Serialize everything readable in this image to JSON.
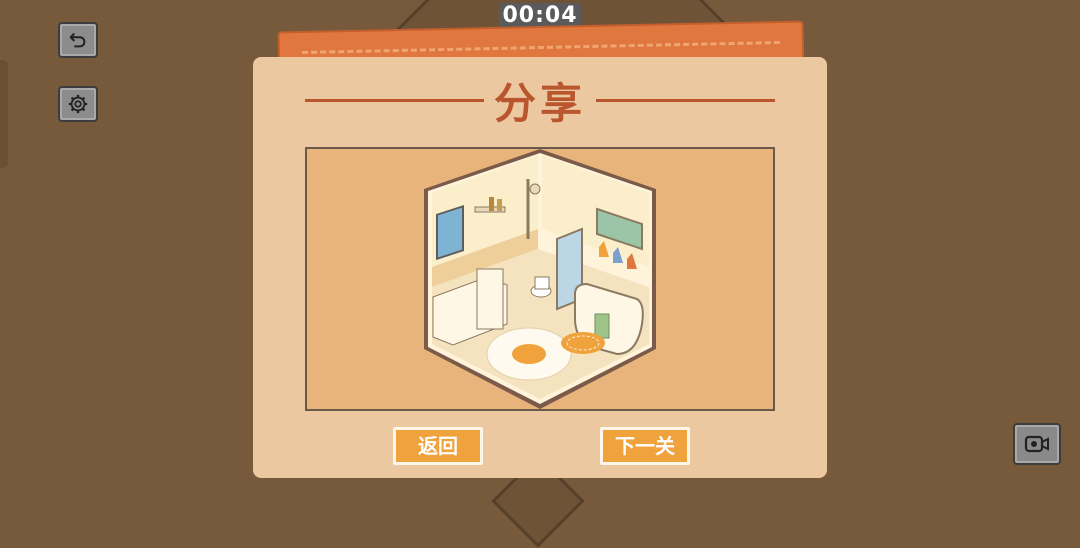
{
  "hud": {
    "timer": "00:04",
    "undo_icon": "undo-arrow-icon",
    "settings_icon": "gear-icon",
    "video_icon": "video-camera-icon"
  },
  "share_dialog": {
    "title": "分享",
    "back_label": "返回",
    "next_label": "下一关"
  },
  "colors": {
    "background": "#775a3b",
    "card": "#ecc8a1",
    "accent": "#b9562e",
    "button": "#f0a23c",
    "tab": "#e0773f",
    "preview_bg": "#e9b47c"
  }
}
